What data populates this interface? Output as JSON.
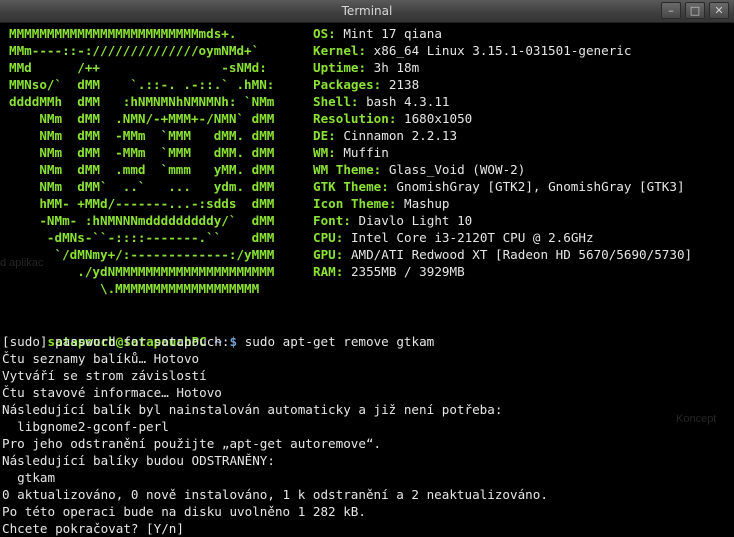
{
  "window": {
    "title": "Terminal",
    "buttons": {
      "minimize": "–",
      "maximize": "□",
      "close": "✕"
    }
  },
  "ascii_logo": [
    "MMMMMMMMMMMMMMMMMMMMMMMMMmds+.",
    "MMm----::-://////////////oymNMd+`",
    "MMd      /++                -sNMd:",
    "MMNso/`  dMM    `.::-. .-::.` .hMN:",
    "ddddMMh  dMM   :hNMNMNhNMNMNh: `NMm",
    "    NMm  dMM  .NMN/-+MMM+-/NMN` dMM",
    "    NMm  dMM  -MMm  `MMM   dMM. dMM",
    "    NMm  dMM  -MMm  `MMM   dMM. dMM",
    "    NMm  dMM  .mmd  `mmm   yMM. dMM",
    "    NMm  dMM`  ..`   ...   ydm. dMM",
    "    hMM- +MMd/-------...-:sdds  dMM",
    "    -NMm- :hNMNNNmdddddddddy/`  dMM",
    "     -dMNs-``-::::-------.``    dMM",
    "      `/dMNmy+/:-------------:/yMMM",
    "         ./ydNMMMMMMMMMMMMMMMMMMMMM",
    "            \\.MMMMMMMMMMMMMMMMMMM"
  ],
  "sysinfo": [
    {
      "key": "OS:",
      "value": "Mint 17 qiana"
    },
    {
      "key": "Kernel:",
      "value": "x86_64 Linux 3.15.1-031501-generic"
    },
    {
      "key": "Uptime:",
      "value": "3h 18m"
    },
    {
      "key": "Packages:",
      "value": "2138"
    },
    {
      "key": "Shell:",
      "value": "bash 4.3.11"
    },
    {
      "key": "Resolution:",
      "value": "1680x1050"
    },
    {
      "key": "DE:",
      "value": "Cinnamon 2.2.13"
    },
    {
      "key": "WM:",
      "value": "Muffin"
    },
    {
      "key": "WM Theme:",
      "value": "Glass_Void (WOW-2)"
    },
    {
      "key": "GTK Theme:",
      "value": "GnomishGray [GTK2], GnomishGray [GTK3]"
    },
    {
      "key": "Icon Theme:",
      "value": "Mashup"
    },
    {
      "key": "Font:",
      "value": "Diavlo Light 10"
    },
    {
      "key": "CPU:",
      "value": "Intel Core i3-2120T CPU @ 2.6GHz"
    },
    {
      "key": "GPU:",
      "value": "AMD/ATI Redwood XT [Radeon HD 5670/5690/5730]"
    },
    {
      "key": "RAM:",
      "value": "2355MB / 3929MB"
    }
  ],
  "prompt": {
    "user_host": "satapouch@satapouchPC",
    "path": "~",
    "symbol": "$",
    "command": "sudo apt-get remove gtkam"
  },
  "output": [
    "[sudo] password for satapouch:",
    "Čtu seznamy balíků… Hotovo",
    "Vytváří se strom závislostí",
    "Čtu stavové informace… Hotovo",
    "Následující balík byl nainstalován automaticky a již není potřeba:",
    "  libgnome2-gconf-perl",
    "Pro jeho odstranění použijte „apt-get autoremove“.",
    "Následující balíky budou ODSTRANĚNY:",
    "  gtkam",
    "0 aktualizováno, 0 nově instalováno, 1 k odstranění a 2 neaktualizováno.",
    "Po této operaci bude na disku uvolněno 1 282 kB.",
    "Chcete pokračovat? [Y/n]"
  ],
  "background_ghost_text": {
    "left": "d aplikac",
    "right": "Koncept"
  }
}
